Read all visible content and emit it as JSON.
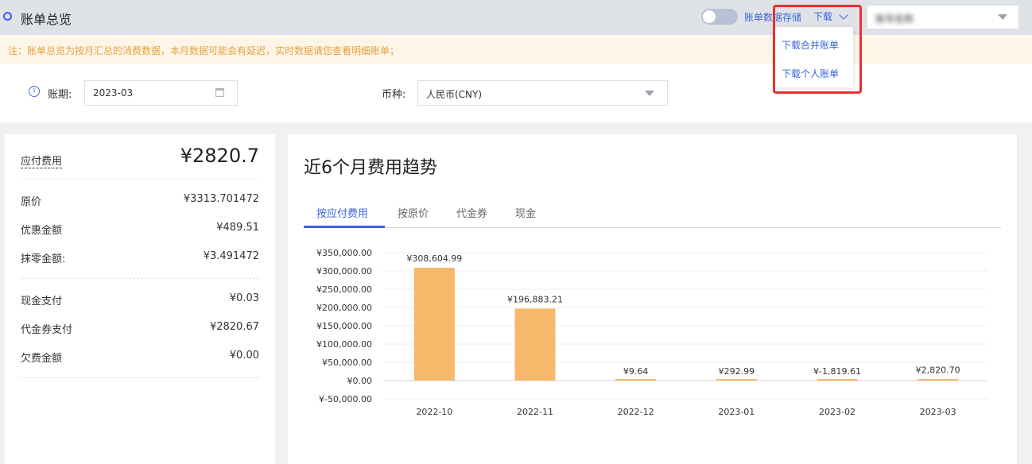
{
  "header": {
    "title": "账单总览",
    "toggle_label": "账单数据存储",
    "download_label": "下载",
    "account_value": "账号名称"
  },
  "download_menu": {
    "items": [
      "下载合并账单",
      "下载个人账单"
    ]
  },
  "notice": "注：账单总览为按月汇总的消费数据，本月数据可能会有延迟，实时数据请您查看明细账单；",
  "filters": {
    "period_label": "账期:",
    "period_value": "2023-03",
    "currency_label": "币种:",
    "currency_value": "人民币(CNY)"
  },
  "summary": {
    "total_label": "应付费用",
    "total_value": "¥2820.7",
    "rows1": [
      {
        "label": "原价",
        "value": "¥3313.701472"
      },
      {
        "label": "优惠金额",
        "value": "¥489.51"
      },
      {
        "label": "抹零金额:",
        "value": "¥3.491472"
      }
    ],
    "rows2": [
      {
        "label": "现金支付",
        "value": "¥0.03"
      },
      {
        "label": "代金券支付",
        "value": "¥2820.67"
      },
      {
        "label": "欠费金额",
        "value": "¥0.00"
      }
    ]
  },
  "trend": {
    "title": "近6个月费用趋势",
    "tabs": [
      "按应付费用",
      "按原价",
      "代金券",
      "现金"
    ],
    "active_tab": 0
  },
  "colors": {
    "accent": "#3c63d8",
    "bar": "#f6b86a",
    "highlight": "#e5322d",
    "notice_text": "#e6a23c"
  },
  "chart_data": {
    "type": "bar",
    "categories": [
      "2022-10",
      "2022-11",
      "2022-12",
      "2023-01",
      "2023-02",
      "2023-03"
    ],
    "values": [
      308604.99,
      196883.21,
      9.64,
      292.99,
      -1819.61,
      2820.7
    ],
    "data_labels": [
      "¥308,604.99",
      "¥196,883.21",
      "¥9.64",
      "¥292.99",
      "¥-1,819.61",
      "¥2,820.70"
    ],
    "y_ticks": [
      "¥350,000.00",
      "¥300,000.00",
      "¥250,000.00",
      "¥200,000.00",
      "¥150,000.00",
      "¥100,000.00",
      "¥50,000.00",
      "¥0.00",
      "¥-50,000.00"
    ],
    "ylim": [
      -50000,
      350000
    ],
    "grid": true,
    "title": "",
    "xlabel": "",
    "ylabel": ""
  }
}
